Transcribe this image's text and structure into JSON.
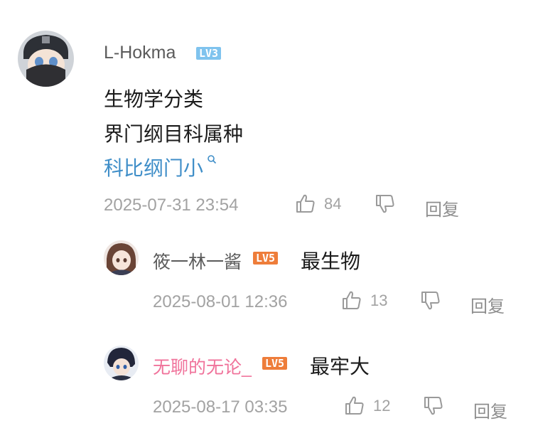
{
  "main_comment": {
    "username": "L-Hokma",
    "level": "LV3",
    "lines": [
      "生物学分类",
      "界门纲目科属种"
    ],
    "link_text": "科比纲门小",
    "timestamp": "2025-07-31 23:54",
    "likes": "84",
    "reply_label": "回复"
  },
  "replies": [
    {
      "username": "筱一林一酱",
      "level": "LV5",
      "text": "最生物",
      "timestamp": "2025-08-01 12:36",
      "likes": "13",
      "reply_label": "回复"
    },
    {
      "username": "无聊的无论_",
      "level": "LV5",
      "text": "最牢大",
      "timestamp": "2025-08-17 03:35",
      "likes": "12",
      "reply_label": "回复"
    }
  ],
  "colors": {
    "level3_badge": "#7fc3ee",
    "level5_badge": "#ee7d3a",
    "link": "#3f8ec8",
    "vip_username": "#f0739b"
  }
}
